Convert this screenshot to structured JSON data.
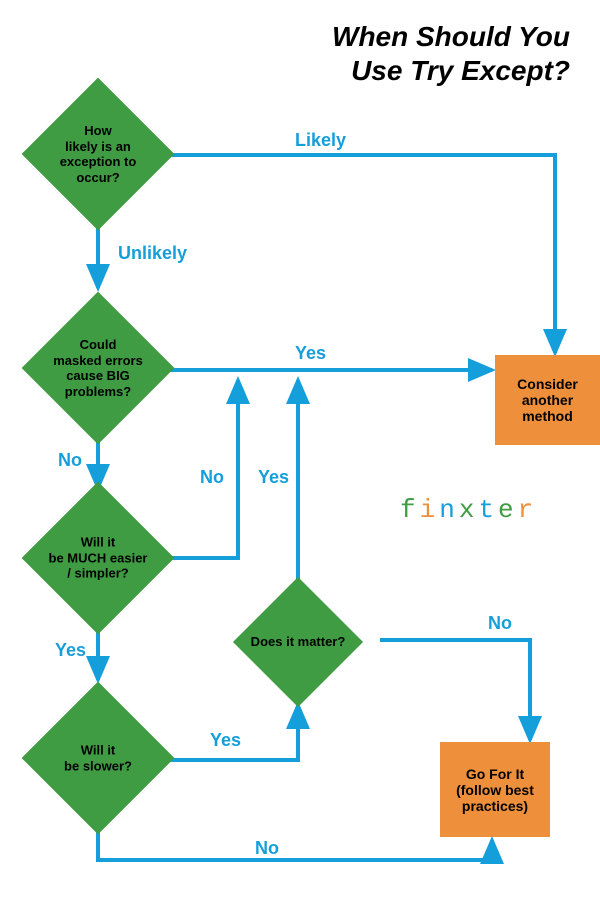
{
  "title_line1": "When Should You",
  "title_line2": "Use Try Except?",
  "nodes": {
    "q1": "How\nlikely is an\nexception to\noccur?",
    "q2": "Could\nmasked errors\ncause BIG\nproblems?",
    "q3": "Will it\nbe MUCH easier\n/ simpler?",
    "q4": "Will it\nbe slower?",
    "q5": "Does it matter?",
    "r1": "Consider another method",
    "r2": "Go For It (follow best practices)"
  },
  "labels": {
    "likely": "Likely",
    "unlikely": "Unlikely",
    "yes_q2": "Yes",
    "no_q2": "No",
    "no_q3": "No",
    "yes_q3": "Yes",
    "yes_q4": "Yes",
    "no_q4": "No",
    "yes_q5": "Yes",
    "no_q5": "No"
  },
  "brand": "finxter",
  "colors": {
    "green": "#3f9c42",
    "orange": "#ee8f3b",
    "blue": "#159fda"
  }
}
